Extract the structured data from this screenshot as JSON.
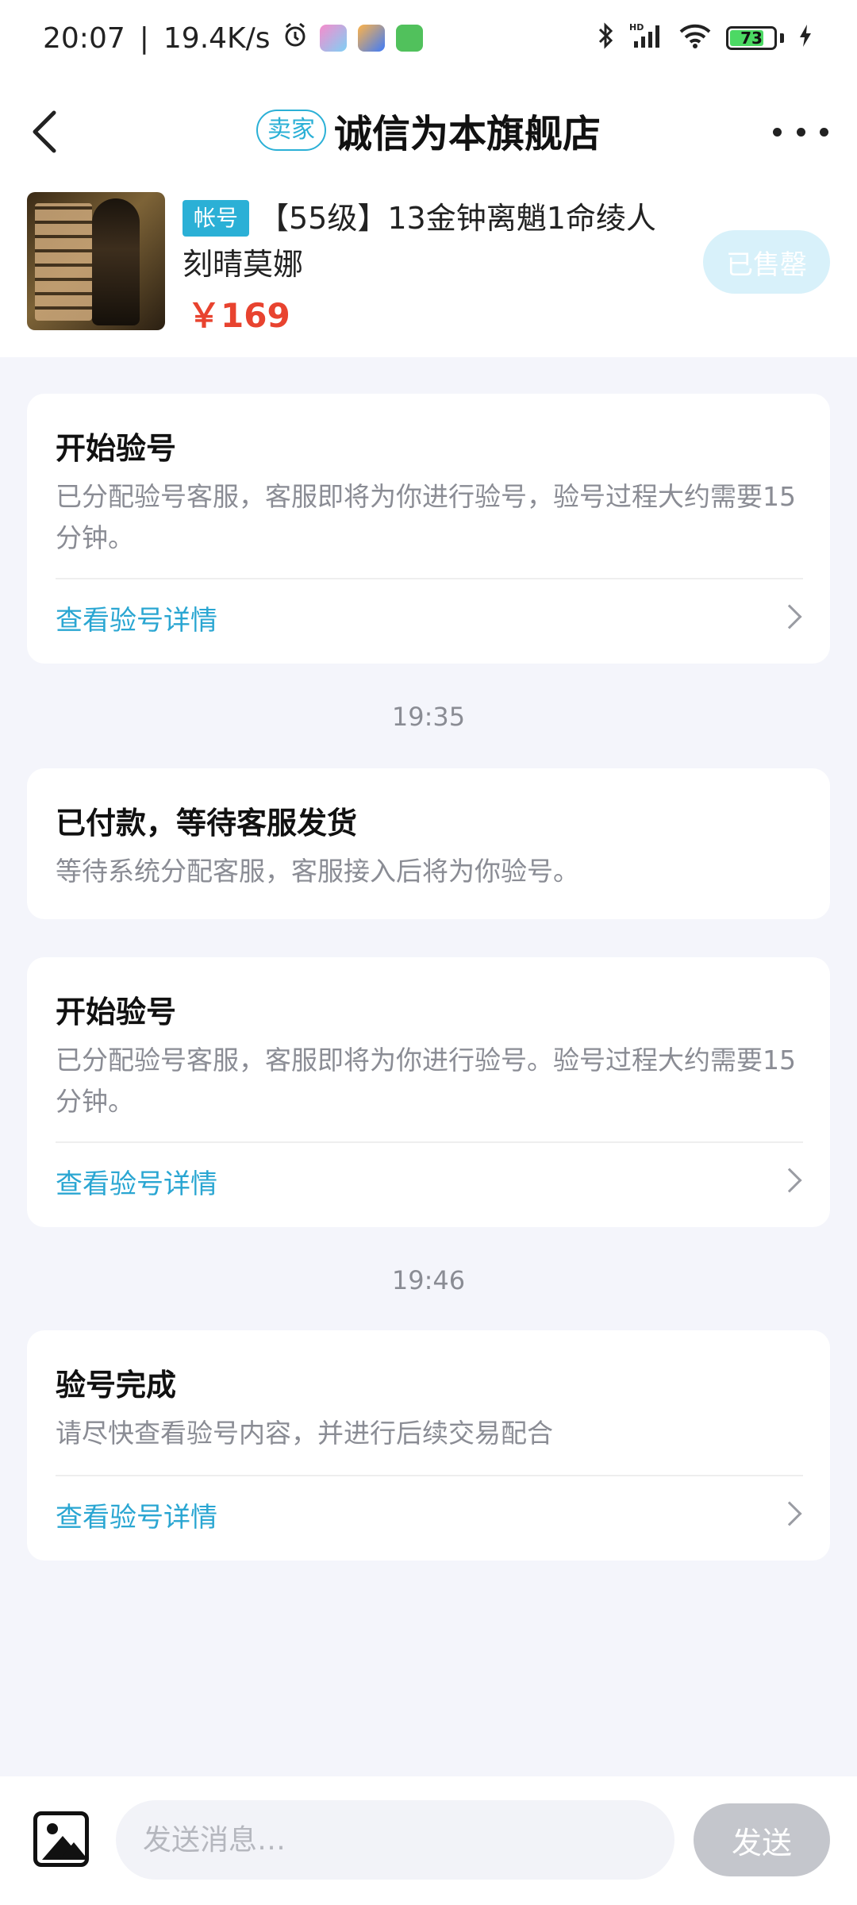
{
  "status_bar": {
    "time": "20:07",
    "network_speed": "19.4K/s",
    "battery_level": "73"
  },
  "header": {
    "seller_badge": "卖家",
    "shop_name": "诚信为本旗舰店"
  },
  "product": {
    "tag": "帐号",
    "name": "【55级】13金钟离魈1命绫人刻晴莫娜",
    "price": "￥169",
    "status_button": "已售罄"
  },
  "messages": [
    {
      "title": "开始验号",
      "desc": "已分配验号客服，客服即将为你进行验号，验号过程大约需要15分钟。",
      "link": "查看验号详情"
    },
    {
      "time": "19:35"
    },
    {
      "title": "已付款，等待客服发货",
      "desc": "等待系统分配客服，客服接入后将为你验号。"
    },
    {
      "title": "开始验号",
      "desc": "已分配验号客服，客服即将为你进行验号。验号过程大约需要15分钟。",
      "link": "查看验号详情"
    },
    {
      "time": "19:46"
    },
    {
      "title": "验号完成",
      "desc": "请尽快查看验号内容，并进行后续交易配合",
      "link": "查看验号详情"
    }
  ],
  "input_bar": {
    "placeholder": "发送消息…",
    "send_label": "发送"
  }
}
